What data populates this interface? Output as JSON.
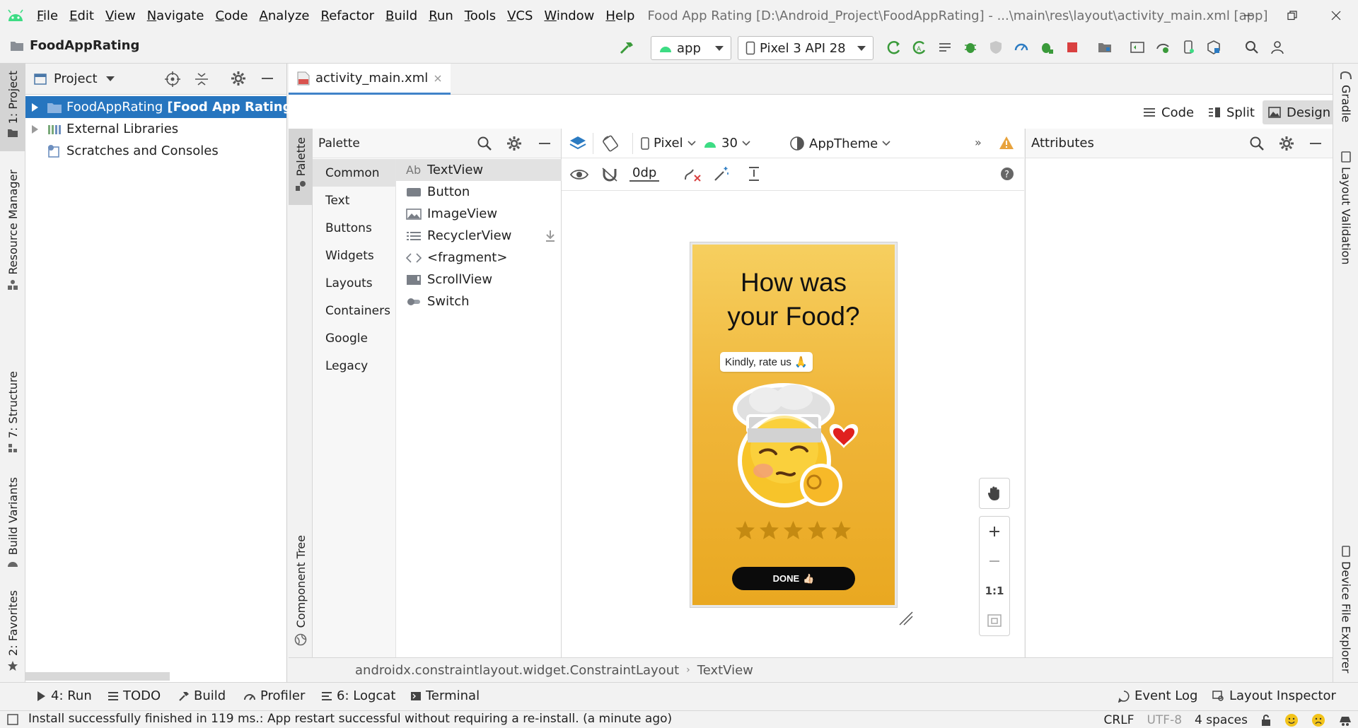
{
  "menubar": {
    "items": [
      "File",
      "Edit",
      "View",
      "Navigate",
      "Code",
      "Analyze",
      "Refactor",
      "Build",
      "Run",
      "Tools",
      "VCS",
      "Window",
      "Help"
    ],
    "window_title": "Food App Rating [D:\\Android_Project\\FoodAppRating] - ...\\main\\res\\layout\\activity_main.xml [app]"
  },
  "toolbar": {
    "project_name": "FoodAppRating",
    "run_config": "app",
    "device": "Pixel 3 API 28"
  },
  "left_strip": {
    "project": "1: Project",
    "resource_manager": "Resource Manager",
    "structure": "7: Structure",
    "build_variants": "Build Variants",
    "favorites": "2: Favorites"
  },
  "project_panel": {
    "title": "Project",
    "tree": [
      {
        "label": "FoodAppRating",
        "suffix": "[Food App Rating]",
        "selected": true
      },
      {
        "label": "External Libraries"
      },
      {
        "label": "Scratches and Consoles"
      }
    ]
  },
  "editor": {
    "file_tab": "activity_main.xml",
    "modes": [
      "Code",
      "Split",
      "Design"
    ],
    "active_mode": "Design"
  },
  "palette": {
    "side_tab": "Palette",
    "component_tree_tab": "Component Tree",
    "title": "Palette",
    "categories": [
      "Common",
      "Text",
      "Buttons",
      "Widgets",
      "Layouts",
      "Containers",
      "Google",
      "Legacy"
    ],
    "active_category": "Common",
    "items": [
      "TextView",
      "Button",
      "ImageView",
      "RecyclerView",
      "<fragment>",
      "ScrollView",
      "Switch"
    ],
    "active_item": "TextView",
    "textview_prefix": "Ab"
  },
  "design_toolbar": {
    "device": "Pixel",
    "api": "30",
    "theme": "AppTheme",
    "margin": "0dp"
  },
  "phone": {
    "title_line1": "How was",
    "title_line2": "your Food?",
    "chip_text": "Kindly, rate us",
    "chip_emoji": "🙏",
    "rating": 0,
    "star_count": 5,
    "done_label": "DONE",
    "done_emoji": "👍🏻"
  },
  "zoom": {
    "one_to_one": "1:1"
  },
  "attributes": {
    "title": "Attributes"
  },
  "right_strip": {
    "gradle": "Gradle",
    "layout_validation": "Layout Validation",
    "device_file_explorer": "Device File Explorer"
  },
  "breadcrumb": {
    "items": [
      "androidx.constraintlayout.widget.ConstraintLayout",
      "TextView"
    ]
  },
  "bottom_tabs": {
    "run": "4: Run",
    "todo": "TODO",
    "build": "Build",
    "profiler": "Profiler",
    "logcat": "6: Logcat",
    "terminal": "Terminal",
    "event_log": "Event Log",
    "layout_inspector": "Layout Inspector"
  },
  "status_bar": {
    "message": "Install successfully finished in 119 ms.: App restart successful without requiring a re-install. (a minute ago)",
    "line_sep": "CRLF",
    "encoding": "UTF-8",
    "indent": "4 spaces"
  },
  "colors": {
    "accent": "#2675bf",
    "phone_top": "#f6cf5f",
    "phone_bottom": "#e9a821",
    "android_green": "#3ddc84"
  }
}
